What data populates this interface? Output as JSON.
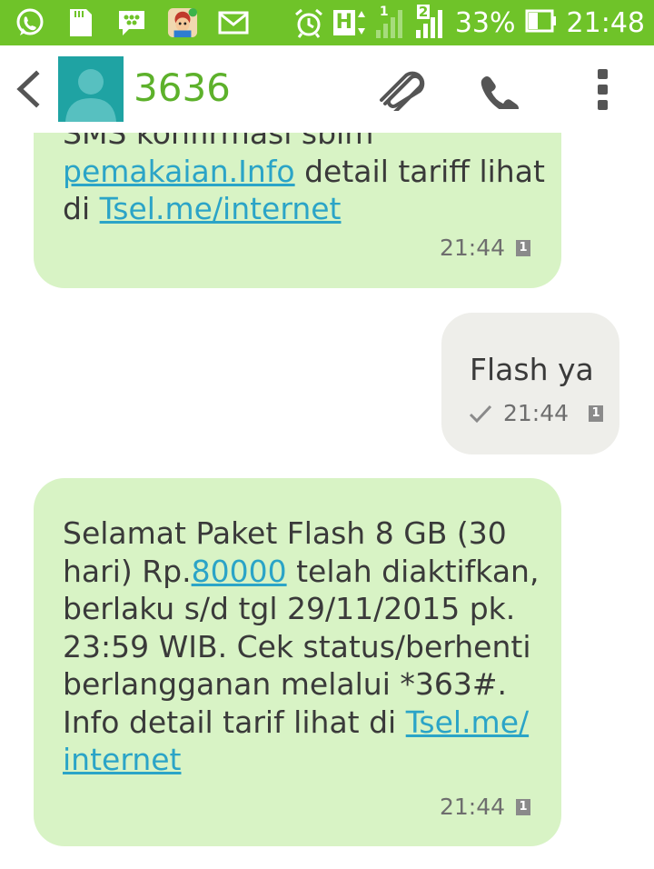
{
  "status_bar": {
    "battery_percent": "33%",
    "time": "21:48",
    "network_type": "H",
    "sim1_label": "1",
    "sim2_label": "2",
    "icons": [
      "whatsapp-icon",
      "sd-card-icon",
      "bbm-icon",
      "game-app-icon",
      "email-icon",
      "alarm-icon",
      "network-h-icon",
      "signal-sim1-icon",
      "signal-sim2-icon",
      "battery-icon"
    ]
  },
  "header": {
    "contact_name": "3636",
    "icons": [
      "back-icon",
      "contact-avatar-icon",
      "attach-icon",
      "call-icon",
      "more-icon"
    ]
  },
  "messages": [
    {
      "direction": "incoming",
      "lines": [
        {
          "segments": [
            {
              "text": "SMS konfirmasi sblm"
            }
          ]
        },
        {
          "segments": [
            {
              "text": "pemakaian.Info",
              "link": true
            },
            {
              "text": " detail tariff lihat"
            }
          ]
        },
        {
          "segments": [
            {
              "text": "di "
            },
            {
              "text": "Tsel.me/internet",
              "link": true
            }
          ]
        }
      ],
      "time": "21:44",
      "sim": "1"
    },
    {
      "direction": "outgoing",
      "text": "Flash ya",
      "time": "21:44",
      "sim": "1",
      "sent_status": "check-icon"
    },
    {
      "direction": "incoming",
      "lines": [
        {
          "segments": [
            {
              "text": "Selamat Paket Flash 8 GB (30"
            }
          ]
        },
        {
          "segments": [
            {
              "text": "hari) Rp."
            },
            {
              "text": "80000",
              "link": true
            },
            {
              "text": " telah diaktifkan,"
            }
          ]
        },
        {
          "segments": [
            {
              "text": "berlaku s/d tgl 29/11/2015 pk."
            }
          ]
        },
        {
          "segments": [
            {
              "text": "23:59 WIB. Cek status/berhenti"
            }
          ]
        },
        {
          "segments": [
            {
              "text": "berlangganan melalui *363#."
            }
          ]
        },
        {
          "segments": [
            {
              "text": "Info detail tarif lihat di "
            },
            {
              "text": "Tsel.me/",
              "link": true
            }
          ]
        },
        {
          "segments": [
            {
              "text": "internet",
              "link": true
            }
          ]
        }
      ],
      "time": "21:44",
      "sim": "1"
    }
  ],
  "colors": {
    "status_bar_bg": "#6fc329",
    "contact_name": "#5db12b",
    "incoming_bubble": "#d8f3c5",
    "outgoing_bubble": "#eeeeea",
    "link": "#2ba4c7"
  }
}
